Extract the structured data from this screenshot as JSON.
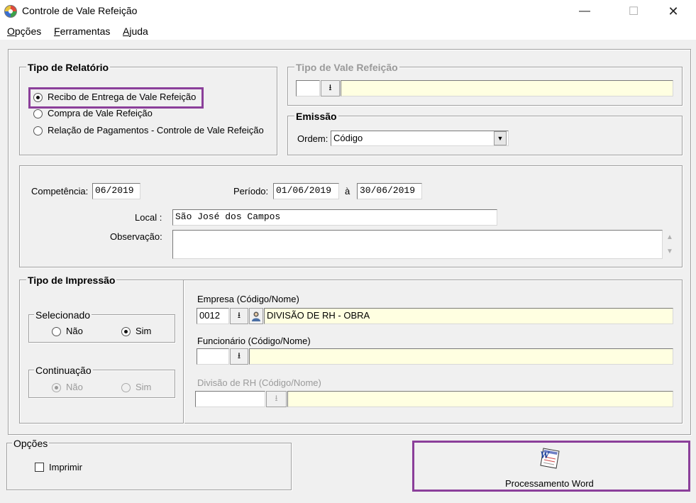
{
  "window": {
    "title": "Controle de Vale Refeição",
    "minimize_glyph": "—",
    "maximize_glyph": "☐",
    "close_glyph": "✕"
  },
  "menu": {
    "items": [
      {
        "ul": "O",
        "rest": "pções"
      },
      {
        "ul": "F",
        "rest": "erramentas"
      },
      {
        "ul": "A",
        "rest": "juda"
      }
    ]
  },
  "tipo_relatorio": {
    "legend": "Tipo de Relatório",
    "options": [
      {
        "label": "Recibo de Entrega de Vale Refeição",
        "selected": true
      },
      {
        "label": "Compra de Vale Refeição",
        "selected": false
      },
      {
        "label": "Relação de Pagamentos - Controle de Vale Refeição",
        "selected": false
      }
    ]
  },
  "tipo_vale": {
    "legend": "Tipo de Vale Refeição",
    "code": "",
    "name": ""
  },
  "emissao": {
    "legend": "Emissão",
    "ordem_label": "Ordem:",
    "ordem_value": "Código"
  },
  "periodo": {
    "competencia_label": "Competência:",
    "competencia_value": "06/2019",
    "periodo_label": "Período:",
    "periodo_inicio": "01/06/2019",
    "a_label": "à",
    "periodo_fim": "30/06/2019",
    "local_label": "Local :",
    "local_value": "São José dos Campos",
    "observacao_label": "Observação:",
    "observacao_value": ""
  },
  "tipo_impressao": {
    "legend": "Tipo de Impressão",
    "selecionado": {
      "legend": "Selecionado",
      "nao": "Não",
      "sim": "Sim",
      "value": "Sim"
    },
    "continuacao": {
      "legend": "Continuação",
      "nao": "Não",
      "sim": "Sim",
      "value": "Não"
    },
    "empresa_label": "Empresa (Código/Nome)",
    "empresa_code": "0012",
    "empresa_name": "DIVISÃO DE RH - OBRA",
    "funcionario_label": "Funcionário (Código/Nome)",
    "funcionario_code": "",
    "funcionario_name": "",
    "divisao_label": "Divisão de RH (Código/Nome)",
    "divisao_code": "",
    "divisao_name": ""
  },
  "opcoes": {
    "legend": "Opções",
    "imprimir_label": "Imprimir",
    "imprimir_checked": false
  },
  "word_button": {
    "label": "Processamento Word",
    "icon": "word-document-icon"
  },
  "icons": {
    "lookup": "⭳"
  },
  "colors": {
    "highlight": "#8b3f9a",
    "lookup_field": "#ffffe1",
    "window_bg": "#f0f0f0"
  }
}
